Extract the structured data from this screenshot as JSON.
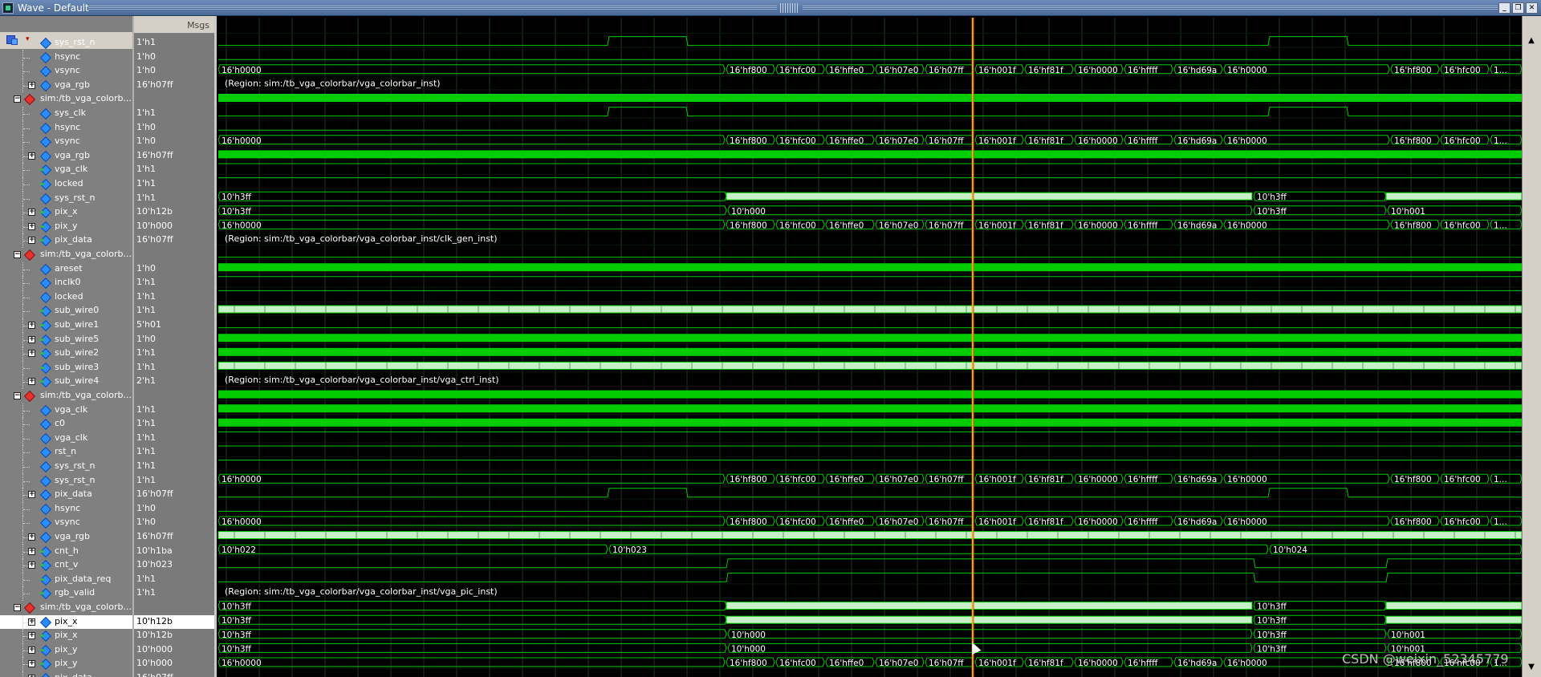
{
  "window": {
    "title": "Wave - Default"
  },
  "header": {
    "msgs_label": "Msgs"
  },
  "colors": {
    "waveform": "#00cc00",
    "bus_dense": "#c8f0c8",
    "cursor": "#f2b011",
    "background": "#000000",
    "grid": "#1e3a1e"
  },
  "watermark": "CSDN @weixin_52345779",
  "rows": [
    {
      "type": "signal",
      "name": "sys_rst_n",
      "value": "1'h1",
      "depth": 2,
      "icon": "input-diamond-icon"
    },
    {
      "type": "signal",
      "name": "hsync",
      "value": "1'h0",
      "depth": 2,
      "icon": "output-diamond-icon",
      "wave": "hsync"
    },
    {
      "type": "signal",
      "name": "vsync",
      "value": "1'h0",
      "depth": 2,
      "icon": "output-diamond-icon",
      "wave": "low"
    },
    {
      "type": "bus",
      "name": "vga_rgb",
      "value": "16'h07ff",
      "depth": 2,
      "icon": "output-diamond-icon",
      "wave": "rgb"
    },
    {
      "type": "region",
      "name": "sim:/tb_vga_colorb...",
      "value": "",
      "depth": 1,
      "region": "(Region: sim:/tb_vga_colorbar/vga_colorbar_inst)"
    },
    {
      "type": "signal",
      "name": "sys_clk",
      "value": "1'h1",
      "depth": 2,
      "icon": "input-diamond-icon",
      "wave": "clk"
    },
    {
      "type": "signal",
      "name": "hsync",
      "value": "1'h0",
      "depth": 2,
      "icon": "output-diamond-icon",
      "wave": "hsync"
    },
    {
      "type": "signal",
      "name": "vsync",
      "value": "1'h0",
      "depth": 2,
      "icon": "output-diamond-icon",
      "wave": "low"
    },
    {
      "type": "bus",
      "name": "vga_rgb",
      "value": "16'h07ff",
      "depth": 2,
      "icon": "output-diamond-icon",
      "wave": "rgb"
    },
    {
      "type": "signal",
      "name": "vga_clk",
      "value": "1'h1",
      "depth": 2,
      "icon": "inout-diamond-icon",
      "wave": "clk"
    },
    {
      "type": "signal",
      "name": "locked",
      "value": "1'h1",
      "depth": 2,
      "icon": "inout-diamond-icon",
      "wave": "high"
    },
    {
      "type": "signal",
      "name": "sys_rst_n",
      "value": "1'h1",
      "depth": 2,
      "icon": "input-diamond-icon",
      "wave": "high"
    },
    {
      "type": "bus",
      "name": "pix_x",
      "value": "10'h12b",
      "depth": 2,
      "icon": "inout-diamond-icon",
      "wave": "pixx"
    },
    {
      "type": "bus",
      "name": "pix_y",
      "value": "10'h000",
      "depth": 2,
      "icon": "inout-diamond-icon",
      "wave": "pixy"
    },
    {
      "type": "bus",
      "name": "pix_data",
      "value": "16'h07ff",
      "depth": 2,
      "icon": "inout-diamond-icon",
      "wave": "rgb"
    },
    {
      "type": "region",
      "name": "sim:/tb_vga_colorb...",
      "value": "",
      "depth": 1,
      "region": "(Region: sim:/tb_vga_colorbar/vga_colorbar_inst/clk_gen_inst)"
    },
    {
      "type": "signal",
      "name": "areset",
      "value": "1'h0",
      "depth": 2,
      "icon": "input-diamond-icon",
      "wave": "low"
    },
    {
      "type": "signal",
      "name": "inclk0",
      "value": "1'h1",
      "depth": 2,
      "icon": "input-diamond-icon",
      "wave": "clk"
    },
    {
      "type": "signal",
      "name": "locked",
      "value": "1'h1",
      "depth": 2,
      "icon": "output-diamond-icon",
      "wave": "high"
    },
    {
      "type": "signal",
      "name": "sub_wire0",
      "value": "1'h1",
      "depth": 2,
      "icon": "inout-diamond-icon",
      "wave": "high"
    },
    {
      "type": "bus",
      "name": "sub_wire1",
      "value": "5'h01",
      "depth": 2,
      "icon": "inout-diamond-icon",
      "wave": "densebus"
    },
    {
      "type": "bus",
      "name": "sub_wire5",
      "value": "1'h0",
      "depth": 2,
      "icon": "inout-diamond-icon",
      "wave": "low"
    },
    {
      "type": "bus",
      "name": "sub_wire2",
      "value": "1'h1",
      "depth": 2,
      "icon": "inout-diamond-icon",
      "wave": "clk"
    },
    {
      "type": "signal",
      "name": "sub_wire3",
      "value": "1'h1",
      "depth": 2,
      "icon": "inout-diamond-icon",
      "wave": "clk"
    },
    {
      "type": "bus",
      "name": "sub_wire4",
      "value": "2'h1",
      "depth": 2,
      "icon": "inout-diamond-icon",
      "wave": "densebus"
    },
    {
      "type": "region",
      "name": "sim:/tb_vga_colorb...",
      "value": "",
      "depth": 1,
      "region": "(Region: sim:/tb_vga_colorbar/vga_colorbar_inst/vga_ctrl_inst)"
    },
    {
      "type": "signal",
      "name": "vga_clk",
      "value": "1'h1",
      "depth": 2,
      "icon": "input-diamond-icon",
      "wave": "clk"
    },
    {
      "type": "signal",
      "name": "c0",
      "value": "1'h1",
      "depth": 2,
      "icon": "output-diamond-icon",
      "wave": "clk"
    },
    {
      "type": "signal",
      "name": "vga_clk",
      "value": "1'h1",
      "depth": 2,
      "icon": "input-diamond-icon",
      "wave": "clk"
    },
    {
      "type": "signal",
      "name": "rst_n",
      "value": "1'h1",
      "depth": 2,
      "icon": "input-diamond-icon",
      "wave": "high"
    },
    {
      "type": "signal",
      "name": "sys_rst_n",
      "value": "1'h1",
      "depth": 2,
      "icon": "input-diamond-icon",
      "wave": "high"
    },
    {
      "type": "signal",
      "name": "sys_rst_n",
      "value": "1'h1",
      "depth": 2,
      "icon": "input-diamond-icon",
      "wave": "high"
    },
    {
      "type": "bus",
      "name": "pix_data",
      "value": "16'h07ff",
      "depth": 2,
      "icon": "input-diamond-icon",
      "wave": "rgb"
    },
    {
      "type": "signal",
      "name": "hsync",
      "value": "1'h0",
      "depth": 2,
      "icon": "output-diamond-icon",
      "wave": "hsync"
    },
    {
      "type": "signal",
      "name": "vsync",
      "value": "1'h0",
      "depth": 2,
      "icon": "output-diamond-icon",
      "wave": "low"
    },
    {
      "type": "bus",
      "name": "vga_rgb",
      "value": "16'h07ff",
      "depth": 2,
      "icon": "output-diamond-icon",
      "wave": "rgb"
    },
    {
      "type": "bus",
      "name": "cnt_h",
      "value": "10'h1ba",
      "depth": 2,
      "icon": "inout-diamond-icon",
      "wave": "densebus"
    },
    {
      "type": "bus",
      "name": "cnt_v",
      "value": "10'h023",
      "depth": 2,
      "icon": "inout-diamond-icon",
      "wave": "cntv"
    },
    {
      "type": "signal",
      "name": "pix_data_req",
      "value": "1'h1",
      "depth": 2,
      "icon": "inout-diamond-icon",
      "wave": "req"
    },
    {
      "type": "signal",
      "name": "rgb_valid",
      "value": "1'h1",
      "depth": 2,
      "icon": "inout-diamond-icon",
      "wave": "req"
    },
    {
      "type": "region",
      "name": "sim:/tb_vga_colorb...",
      "value": "",
      "depth": 1,
      "region": "(Region: sim:/tb_vga_colorbar/vga_colorbar_inst/vga_pic_inst)"
    },
    {
      "type": "bus",
      "name": "pix_x",
      "value": "10'h12b",
      "depth": 2,
      "icon": "input-diamond-icon",
      "wave": "pixx",
      "selected": true
    },
    {
      "type": "bus",
      "name": "pix_x",
      "value": "10'h12b",
      "depth": 2,
      "icon": "inout-diamond-icon",
      "wave": "pixx"
    },
    {
      "type": "bus",
      "name": "pix_y",
      "value": "10'h000",
      "depth": 2,
      "icon": "inout-diamond-icon",
      "wave": "pixy2"
    },
    {
      "type": "bus",
      "name": "pix_y",
      "value": "10'h000",
      "depth": 2,
      "icon": "inout-diamond-icon",
      "wave": "pixy"
    },
    {
      "type": "bus",
      "name": "pix_data",
      "value": "16'h07ff",
      "depth": 2,
      "icon": "output-diamond-icon",
      "wave": "rgb"
    }
  ],
  "bus_values": {
    "rgb": [
      "16'h0000",
      "16'hf800",
      "16'hfc00",
      "16'hffe0",
      "16'h07e0",
      "16'h07ff",
      "16'h001f",
      "16'hf81f",
      "16'h0000",
      "16'hffff",
      "16'hd69a",
      "16'h0000",
      "16'hf800",
      "16'hfc00",
      "1..."
    ],
    "pixx": [
      "10'h3ff",
      "10'h3ff"
    ],
    "pixy": [
      "10'h3ff",
      "10'h000",
      "10'h3ff",
      "10'h001"
    ],
    "pixy2": [
      "10'h3ff",
      "10'h000",
      "10'h3ff",
      "10'h001"
    ],
    "cntv": [
      "10'h022",
      "10'h023",
      "10'h024"
    ]
  }
}
